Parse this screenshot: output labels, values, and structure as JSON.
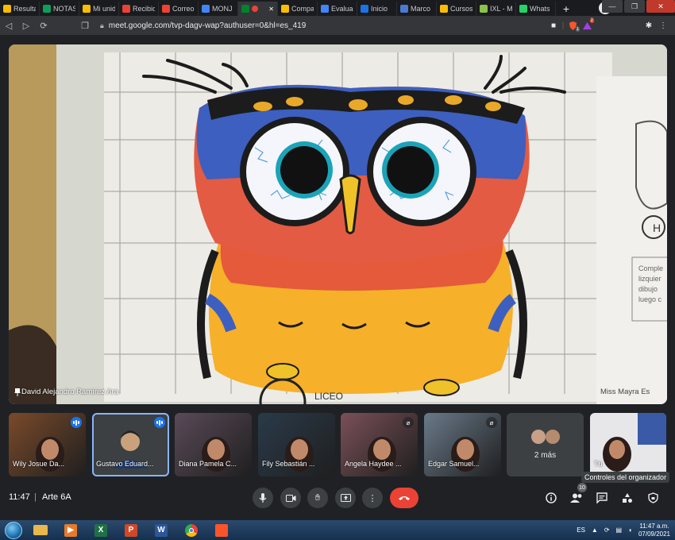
{
  "browser": {
    "tabs": [
      {
        "label": "Resulta",
        "color": "#fbbc04",
        "icon": "drive-icon"
      },
      {
        "label": "NOTAS",
        "color": "#0f9d58",
        "icon": "sheets-icon"
      },
      {
        "label": "Mi unid",
        "color": "#fbbc04",
        "icon": "drive-icon"
      },
      {
        "label": "Recibid",
        "color": "#ea4335",
        "icon": "gmail-icon"
      },
      {
        "label": "Correo",
        "color": "#ea4335",
        "icon": "gmail-icon"
      },
      {
        "label": "MONJ",
        "color": "#4285f4",
        "icon": "contact-icon"
      },
      {
        "label": "",
        "color": "#00832d",
        "icon": "meet-icon"
      },
      {
        "label": "Compa",
        "color": "#fbbc04",
        "icon": "drive-icon"
      },
      {
        "label": "Evaluac",
        "color": "#4285f4",
        "icon": "google-icon"
      },
      {
        "label": "Inicio",
        "color": "#1a73e8",
        "icon": "classroom-icon"
      },
      {
        "label": "Marco",
        "color": "#4a7bd0",
        "icon": "crest-icon"
      },
      {
        "label": "Cursos",
        "color": "#fbbc04",
        "icon": "drive-icon"
      },
      {
        "label": "IXL - M",
        "color": "#8bc34a",
        "icon": "ixl-icon"
      },
      {
        "label": "Whats",
        "color": "#25d366",
        "icon": "whatsapp-icon"
      }
    ],
    "new_tab": "+",
    "url": "meet.google.com/tvp-dagv-wap?authuser=0&hl=es_419",
    "ext_badge_1": "1",
    "ext_badge_2": "2"
  },
  "meet": {
    "main_speaker": "David Alejandro Ramírez Ara",
    "drawing_text_1": "LICEO",
    "drawing_text_2": "Miss Mayra Es",
    "drawing_side_text": [
      "Comple",
      "lizquier",
      "dibujo",
      "luego c"
    ],
    "drawing_letter": "H",
    "participants": [
      {
        "name": "Wily Josue Da...",
        "speaking": true,
        "scene": "#7a4a2a"
      },
      {
        "name": "Gustavo Eduard...",
        "speaking": true,
        "scene": "#3c4043"
      },
      {
        "name": "Diana Pamela C...",
        "speaking": false,
        "scene": "#5a4a58"
      },
      {
        "name": "Fily Sebastián ...",
        "speaking": false,
        "scene": "#2a3a4a"
      },
      {
        "name": "Angela Haydee ...",
        "speaking": false,
        "muted": true,
        "scene": "#7a5058"
      },
      {
        "name": "Edgar Samuel...",
        "speaking": false,
        "muted": true,
        "scene": "#6a7a8a"
      }
    ],
    "more_label": "2 más",
    "self_label": "Tú",
    "organizer_tooltip": "Controles del organizador",
    "participants_count": "10",
    "time": "11:47",
    "meeting_name": "Arte 6A"
  },
  "taskbar": {
    "apps": [
      {
        "name": "explorer",
        "color": "#e8b84a",
        "glyph": ""
      },
      {
        "name": "media",
        "color": "#e87a2a",
        "glyph": "▶"
      },
      {
        "name": "excel",
        "color": "#1e7145",
        "glyph": "X"
      },
      {
        "name": "powerpoint",
        "color": "#d24726",
        "glyph": "P"
      },
      {
        "name": "word",
        "color": "#2b579a",
        "glyph": "W"
      },
      {
        "name": "chrome",
        "color": "#4285f4",
        "glyph": ""
      },
      {
        "name": "brave",
        "color": "#fb542b",
        "glyph": ""
      }
    ],
    "lang": "ES",
    "clock_time": "11:47 a.m.",
    "clock_date": "07/09/2021"
  }
}
